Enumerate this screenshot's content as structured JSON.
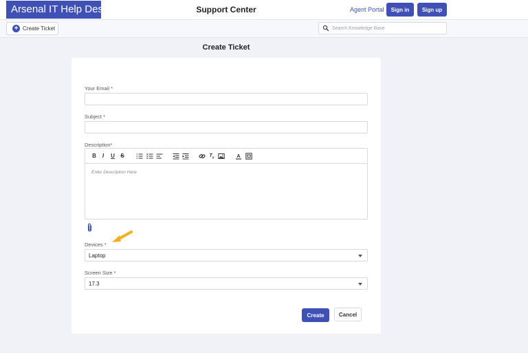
{
  "header": {
    "brand": "Arsenal IT Help Desk",
    "title": "Support Center",
    "agent_portal": "Agent Portal",
    "sign_in": "Sign in",
    "sign_up": "Sign up"
  },
  "toolbar": {
    "create_ticket": "Create Ticket",
    "search_placeholder": "Search Knowledge Base"
  },
  "page": {
    "title": "Create Ticket"
  },
  "form": {
    "email_label": "Your Email *",
    "subject_label": "Subject *",
    "description_label": "Description*",
    "description_placeholder": "Enter Description Here",
    "devices_label": "Devices *",
    "devices_value": "Laptop",
    "screen_label": "Screen Size *",
    "screen_value": "17.3",
    "create": "Create",
    "cancel": "Cancel"
  },
  "icons": {
    "plus": "plus-circle-icon",
    "search": "search-icon",
    "attach": "paperclip-icon",
    "annotation": "arrow-icon"
  },
  "colors": {
    "primary": "#3f51b5",
    "background": "#f0f2f8",
    "arrow": "#f2b01e"
  }
}
